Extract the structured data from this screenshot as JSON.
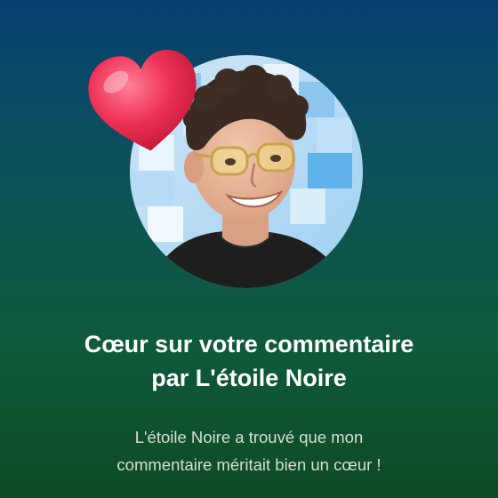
{
  "notification": {
    "title_line1": "Cœur sur votre commentaire",
    "title_line2": "par L'étoile Noire",
    "message_line1": "L'étoile Noire a trouvé que mon",
    "message_line2": "commentaire méritait bien un cœur !"
  },
  "icons": {
    "heart": "heart-icon",
    "avatar": "creator-avatar"
  },
  "colors": {
    "heart": "#e8284e",
    "title": "#ffffff",
    "message": "#d8ded6",
    "background_top": "#073f6f",
    "background_bottom": "#0d4a24"
  }
}
